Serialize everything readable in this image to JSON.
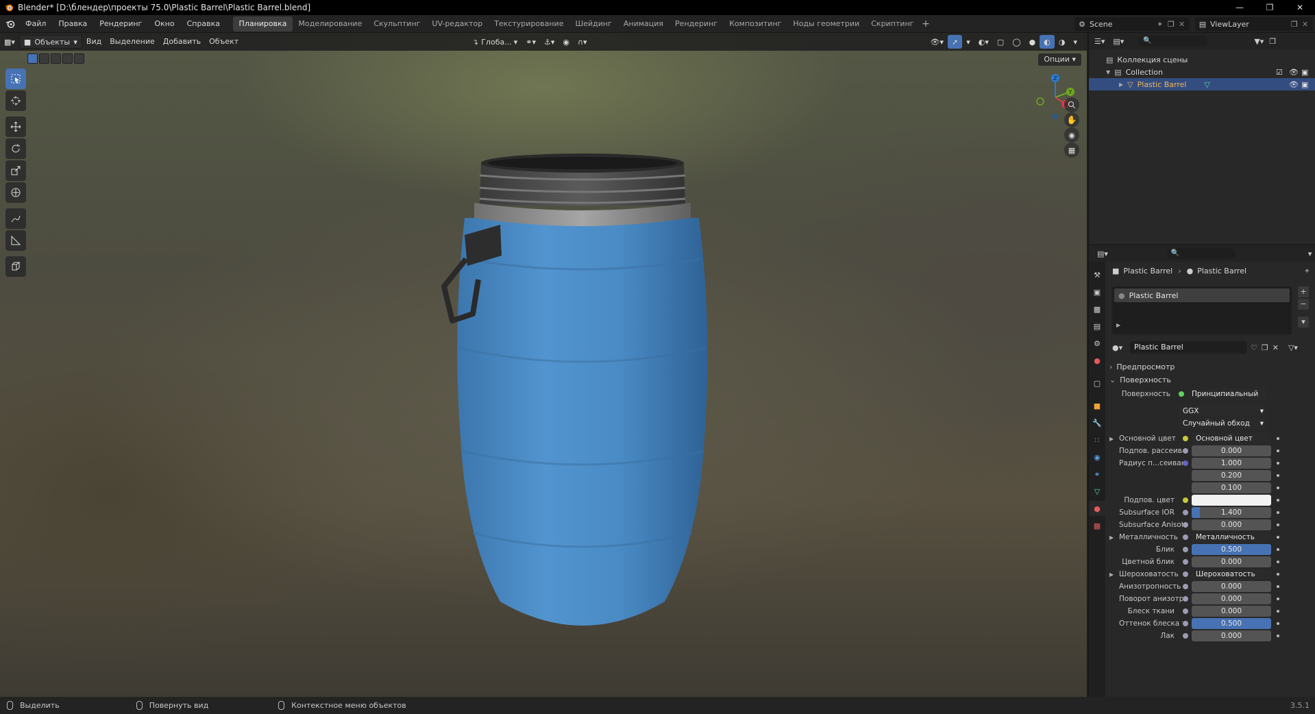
{
  "window": {
    "title": "Blender* [D:\\блендер\\проекты 75.0\\Plastic Barrel\\Plastic Barrel.blend]",
    "controls": [
      "minimize-icon",
      "maximize-icon",
      "close-icon"
    ]
  },
  "menu": [
    "Файл",
    "Правка",
    "Рендеринг",
    "Окно",
    "Справка"
  ],
  "workspaces": [
    {
      "label": "Планировка",
      "active": true
    },
    {
      "label": "Моделирование"
    },
    {
      "label": "Скульптинг"
    },
    {
      "label": "UV-редактор"
    },
    {
      "label": "Текстурирование"
    },
    {
      "label": "Шейдинг"
    },
    {
      "label": "Анимация"
    },
    {
      "label": "Рендеринг"
    },
    {
      "label": "Композитинг"
    },
    {
      "label": "Ноды геометрии"
    },
    {
      "label": "Скриптинг"
    }
  ],
  "scene": {
    "name": "Scene"
  },
  "view_layer": {
    "name": "ViewLayer"
  },
  "viewport": {
    "mode": "Объекты",
    "menu": [
      "Вид",
      "Выделение",
      "Добавить",
      "Объект"
    ],
    "orientation": "Глоба...",
    "options_label": "Опции",
    "gizmo_axes": [
      "X",
      "Y",
      "Z"
    ],
    "tools": [
      "select-box-icon",
      "cursor-icon",
      "move-icon",
      "rotate-icon",
      "scale-icon",
      "transform-icon",
      "annotate-icon",
      "measure-icon",
      "add-cube-icon"
    ]
  },
  "outliner": {
    "root": "Коллекция сцены",
    "collection": "Collection",
    "object": "Plastic Barrel"
  },
  "properties": {
    "breadcrumb": [
      "Plastic Barrel",
      "Plastic Barrel"
    ],
    "material_slot": "Plastic Barrel",
    "material_name": "Plastic Barrel",
    "panels": {
      "preview": "Предпросмотр",
      "surface": "Поверхность"
    },
    "surface_label": "Поверхность",
    "surface_value": "Принципиальный BSDF",
    "distribution": "GGX",
    "subsurface_method": "Случайный обход",
    "rows": [
      {
        "label": "Основной цвет",
        "value": "Основной цвет",
        "type": "link",
        "dot": "#c8c83c",
        "expand": true
      },
      {
        "label": "Подпов. рассеива...",
        "value": "0.000",
        "type": "num",
        "dot": "#9b9bb5"
      },
      {
        "label": "Радиус п...сеивания",
        "value": "1.000",
        "type": "num",
        "dot": "#6363c7"
      },
      {
        "label": "",
        "value": "0.200",
        "type": "num",
        "dot": ""
      },
      {
        "label": "",
        "value": "0.100",
        "type": "num",
        "dot": ""
      },
      {
        "label": "Подпов. цвет",
        "value": "",
        "type": "color",
        "dot": "#c8c83c",
        "color": "#f2f2f2"
      },
      {
        "label": "Subsurface IOR",
        "value": "1.400",
        "type": "num",
        "dot": "#9b9bb5",
        "fill": 0.1
      },
      {
        "label": "Subsurface Anisotr...",
        "value": "0.000",
        "type": "num",
        "dot": "#9b9bb5"
      },
      {
        "label": "Металличность",
        "value": "Металличность",
        "type": "link",
        "dot": "#9b9bb5",
        "expand": true
      },
      {
        "label": "Блик",
        "value": "0.500",
        "type": "num",
        "dot": "#9b9bb5",
        "fill": 1.0
      },
      {
        "label": "Цветной блик",
        "value": "0.000",
        "type": "num",
        "dot": "#9b9bb5"
      },
      {
        "label": "Шероховатость",
        "value": "Шероховатость",
        "type": "link",
        "dot": "#9b9bb5",
        "expand": true
      },
      {
        "label": "Анизотропность",
        "value": "0.000",
        "type": "num",
        "dot": "#9b9bb5"
      },
      {
        "label": "Поворот анизотро...",
        "value": "0.000",
        "type": "num",
        "dot": "#9b9bb5"
      },
      {
        "label": "Блеск ткани",
        "value": "0.000",
        "type": "num",
        "dot": "#9b9bb5"
      },
      {
        "label": "Оттенок блеска тк...",
        "value": "0.500",
        "type": "num",
        "dot": "#9b9bb5",
        "fill": 1.0
      },
      {
        "label": "Лак",
        "value": "0.000",
        "type": "num",
        "dot": "#9b9bb5"
      }
    ]
  },
  "status": {
    "items": [
      "Выделить",
      "Повернуть вид",
      "Контекстное меню объектов"
    ],
    "version": "3.5.1"
  },
  "colors": {
    "accent": "#4772b3",
    "selected_row": "#334d80",
    "selected_text": "#f2b45a",
    "barrel_blue": "#4a8cc6"
  }
}
